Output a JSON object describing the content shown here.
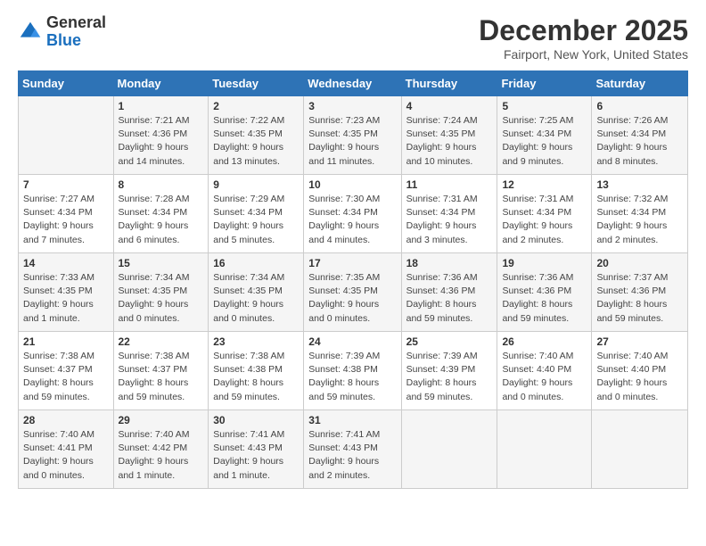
{
  "header": {
    "logo_general": "General",
    "logo_blue": "Blue",
    "month_title": "December 2025",
    "location": "Fairport, New York, United States"
  },
  "days_of_week": [
    "Sunday",
    "Monday",
    "Tuesday",
    "Wednesday",
    "Thursday",
    "Friday",
    "Saturday"
  ],
  "weeks": [
    [
      {
        "day": "",
        "text": ""
      },
      {
        "day": "1",
        "text": "Sunrise: 7:21 AM\nSunset: 4:36 PM\nDaylight: 9 hours and 14 minutes."
      },
      {
        "day": "2",
        "text": "Sunrise: 7:22 AM\nSunset: 4:35 PM\nDaylight: 9 hours and 13 minutes."
      },
      {
        "day": "3",
        "text": "Sunrise: 7:23 AM\nSunset: 4:35 PM\nDaylight: 9 hours and 11 minutes."
      },
      {
        "day": "4",
        "text": "Sunrise: 7:24 AM\nSunset: 4:35 PM\nDaylight: 9 hours and 10 minutes."
      },
      {
        "day": "5",
        "text": "Sunrise: 7:25 AM\nSunset: 4:34 PM\nDaylight: 9 hours and 9 minutes."
      },
      {
        "day": "6",
        "text": "Sunrise: 7:26 AM\nSunset: 4:34 PM\nDaylight: 9 hours and 8 minutes."
      }
    ],
    [
      {
        "day": "7",
        "text": "Sunrise: 7:27 AM\nSunset: 4:34 PM\nDaylight: 9 hours and 7 minutes."
      },
      {
        "day": "8",
        "text": "Sunrise: 7:28 AM\nSunset: 4:34 PM\nDaylight: 9 hours and 6 minutes."
      },
      {
        "day": "9",
        "text": "Sunrise: 7:29 AM\nSunset: 4:34 PM\nDaylight: 9 hours and 5 minutes."
      },
      {
        "day": "10",
        "text": "Sunrise: 7:30 AM\nSunset: 4:34 PM\nDaylight: 9 hours and 4 minutes."
      },
      {
        "day": "11",
        "text": "Sunrise: 7:31 AM\nSunset: 4:34 PM\nDaylight: 9 hours and 3 minutes."
      },
      {
        "day": "12",
        "text": "Sunrise: 7:31 AM\nSunset: 4:34 PM\nDaylight: 9 hours and 2 minutes."
      },
      {
        "day": "13",
        "text": "Sunrise: 7:32 AM\nSunset: 4:34 PM\nDaylight: 9 hours and 2 minutes."
      }
    ],
    [
      {
        "day": "14",
        "text": "Sunrise: 7:33 AM\nSunset: 4:35 PM\nDaylight: 9 hours and 1 minute."
      },
      {
        "day": "15",
        "text": "Sunrise: 7:34 AM\nSunset: 4:35 PM\nDaylight: 9 hours and 0 minutes."
      },
      {
        "day": "16",
        "text": "Sunrise: 7:34 AM\nSunset: 4:35 PM\nDaylight: 9 hours and 0 minutes."
      },
      {
        "day": "17",
        "text": "Sunrise: 7:35 AM\nSunset: 4:35 PM\nDaylight: 9 hours and 0 minutes."
      },
      {
        "day": "18",
        "text": "Sunrise: 7:36 AM\nSunset: 4:36 PM\nDaylight: 8 hours and 59 minutes."
      },
      {
        "day": "19",
        "text": "Sunrise: 7:36 AM\nSunset: 4:36 PM\nDaylight: 8 hours and 59 minutes."
      },
      {
        "day": "20",
        "text": "Sunrise: 7:37 AM\nSunset: 4:36 PM\nDaylight: 8 hours and 59 minutes."
      }
    ],
    [
      {
        "day": "21",
        "text": "Sunrise: 7:38 AM\nSunset: 4:37 PM\nDaylight: 8 hours and 59 minutes."
      },
      {
        "day": "22",
        "text": "Sunrise: 7:38 AM\nSunset: 4:37 PM\nDaylight: 8 hours and 59 minutes."
      },
      {
        "day": "23",
        "text": "Sunrise: 7:38 AM\nSunset: 4:38 PM\nDaylight: 8 hours and 59 minutes."
      },
      {
        "day": "24",
        "text": "Sunrise: 7:39 AM\nSunset: 4:38 PM\nDaylight: 8 hours and 59 minutes."
      },
      {
        "day": "25",
        "text": "Sunrise: 7:39 AM\nSunset: 4:39 PM\nDaylight: 8 hours and 59 minutes."
      },
      {
        "day": "26",
        "text": "Sunrise: 7:40 AM\nSunset: 4:40 PM\nDaylight: 9 hours and 0 minutes."
      },
      {
        "day": "27",
        "text": "Sunrise: 7:40 AM\nSunset: 4:40 PM\nDaylight: 9 hours and 0 minutes."
      }
    ],
    [
      {
        "day": "28",
        "text": "Sunrise: 7:40 AM\nSunset: 4:41 PM\nDaylight: 9 hours and 0 minutes."
      },
      {
        "day": "29",
        "text": "Sunrise: 7:40 AM\nSunset: 4:42 PM\nDaylight: 9 hours and 1 minute."
      },
      {
        "day": "30",
        "text": "Sunrise: 7:41 AM\nSunset: 4:43 PM\nDaylight: 9 hours and 1 minute."
      },
      {
        "day": "31",
        "text": "Sunrise: 7:41 AM\nSunset: 4:43 PM\nDaylight: 9 hours and 2 minutes."
      },
      {
        "day": "",
        "text": ""
      },
      {
        "day": "",
        "text": ""
      },
      {
        "day": "",
        "text": ""
      }
    ]
  ]
}
